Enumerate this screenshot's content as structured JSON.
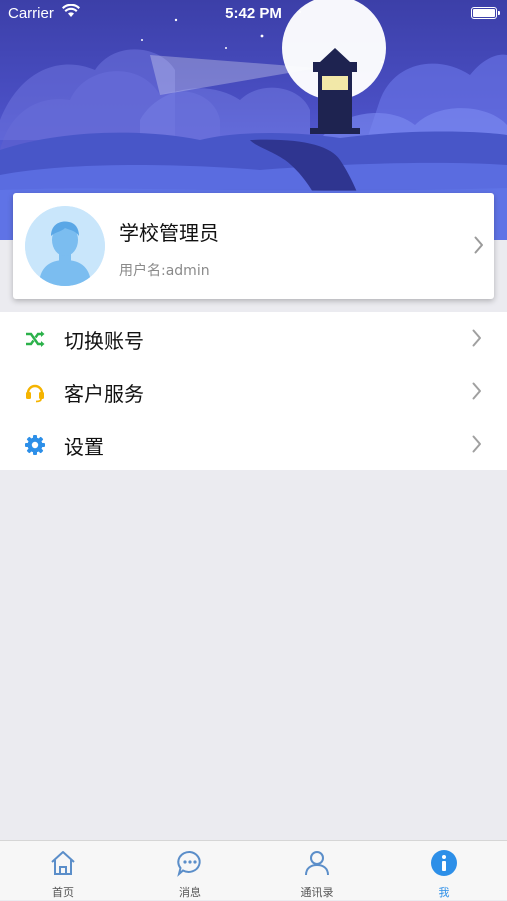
{
  "status_bar": {
    "carrier": "Carrier",
    "time": "5:42 PM"
  },
  "profile": {
    "name": "学校管理员",
    "username": "用户名:admin"
  },
  "menu": {
    "items": [
      {
        "label": "切换账号",
        "icon": "shuffle-icon",
        "color": "#2bb14a"
      },
      {
        "label": "客户服务",
        "icon": "headset-icon",
        "color": "#f5b400"
      },
      {
        "label": "设置",
        "icon": "gear-icon",
        "color": "#2d8fe8"
      }
    ]
  },
  "tab_bar": {
    "active": "我",
    "tabs": [
      {
        "label": "首页",
        "icon": "home-icon"
      },
      {
        "label": "消息",
        "icon": "message-icon"
      },
      {
        "label": "通讯录",
        "icon": "contacts-icon"
      },
      {
        "label": "我",
        "icon": "info-icon"
      }
    ]
  },
  "colors": {
    "accent": "#2d8fe8",
    "hero_dark": "#3c3fa8",
    "hero_light": "#6f7cf0"
  }
}
